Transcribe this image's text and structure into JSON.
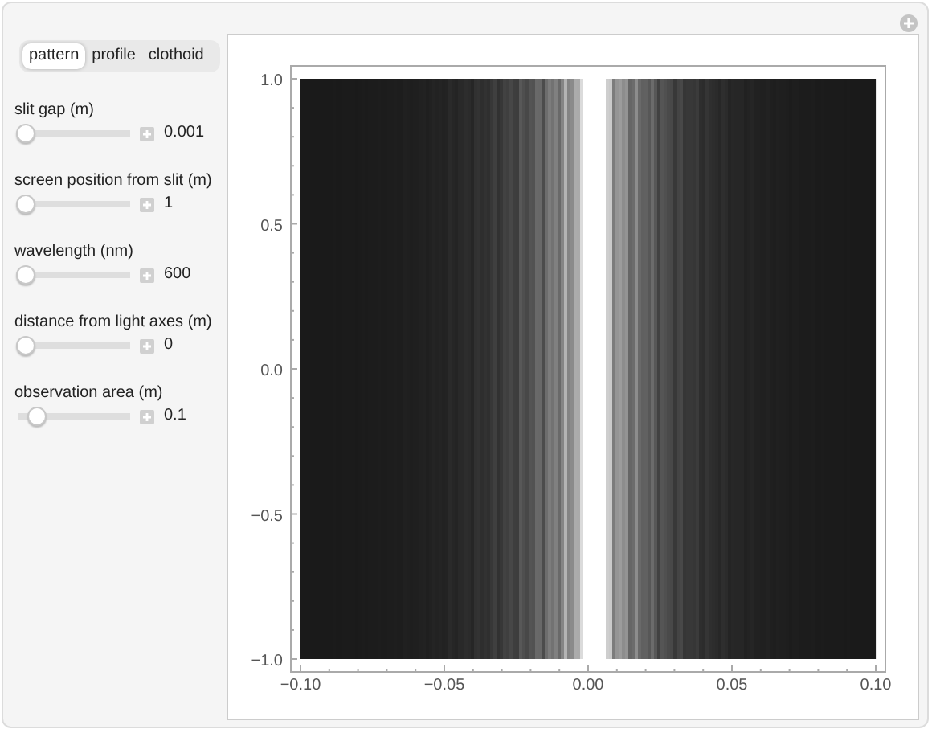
{
  "tabs": [
    {
      "label": "pattern",
      "selected": true
    },
    {
      "label": "profile",
      "selected": false
    },
    {
      "label": "clothoid",
      "selected": false
    }
  ],
  "controls": [
    {
      "label": "slit gap (m)",
      "value": "0.001",
      "level": 0
    },
    {
      "label": "screen position from slit (m)",
      "value": "1",
      "level": 0
    },
    {
      "label": "wavelength (nm)",
      "value": "600",
      "level": 0
    },
    {
      "label": "distance from light axes (m)",
      "value": "0",
      "level": 0
    },
    {
      "label": "observation area (m)",
      "value": "0.1",
      "level": 0.12
    }
  ],
  "plot": {
    "x_ticks": [
      "−0.10",
      "−0.05",
      "0.00",
      "0.05",
      "0.10"
    ],
    "y_ticks": [
      "1.0",
      "0.5",
      "0.0",
      "−0.5",
      "−1.0"
    ]
  }
}
